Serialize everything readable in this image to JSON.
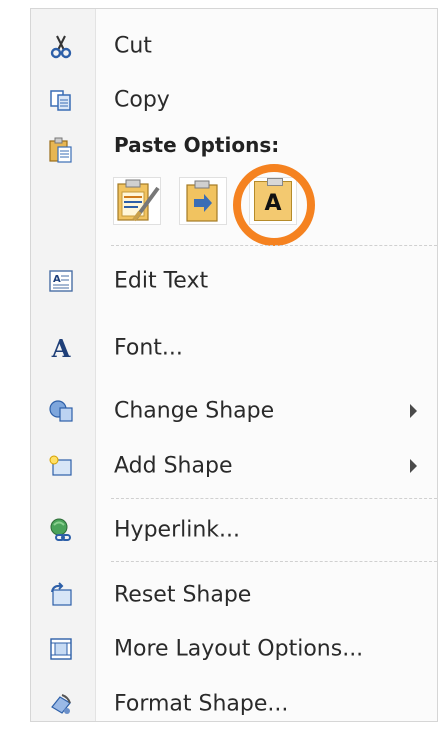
{
  "menu": {
    "items_top": [
      {
        "label": "Cut",
        "icon": "scissors-icon"
      },
      {
        "label": "Copy",
        "icon": "copy-icon"
      }
    ],
    "paste_header": "Paste Options:",
    "paste_options": [
      {
        "name": "use-destination-theme",
        "icon": "paste-format-icon"
      },
      {
        "name": "merge-formatting",
        "icon": "paste-merge-icon"
      },
      {
        "name": "keep-text-only",
        "icon": "paste-text-only-icon",
        "glyph": "A",
        "highlighted": true
      }
    ],
    "items": [
      {
        "label": "Edit Text",
        "icon": "edit-text-icon"
      },
      {
        "label": "Font...",
        "icon": "font-icon"
      },
      {
        "label": "Change Shape",
        "icon": "change-shape-icon",
        "submenu": true
      },
      {
        "label": "Add Shape",
        "icon": "add-shape-icon",
        "submenu": true
      },
      {
        "label": "Hyperlink...",
        "icon": "hyperlink-icon"
      },
      {
        "label": "Reset Shape",
        "icon": "reset-shape-icon"
      },
      {
        "label": "More Layout Options...",
        "icon": "layout-options-icon"
      },
      {
        "label": "Format Shape...",
        "icon": "format-shape-icon"
      }
    ]
  },
  "colors": {
    "highlight": "#f58220",
    "icon_blue": "#3a6db5"
  }
}
